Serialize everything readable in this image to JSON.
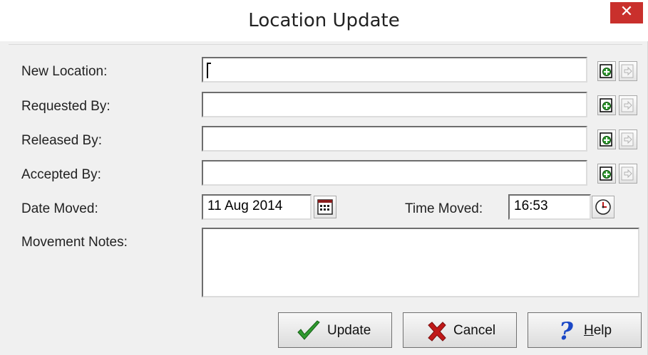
{
  "window": {
    "title": "Location Update",
    "close_glyph": "✕"
  },
  "form": {
    "new_location": {
      "label": "New Location:",
      "value": ""
    },
    "requested_by": {
      "label": "Requested By:",
      "value": ""
    },
    "released_by": {
      "label": "Released By:",
      "value": ""
    },
    "accepted_by": {
      "label": "Accepted By:",
      "value": ""
    },
    "date_moved": {
      "label": "Date Moved:",
      "value": "11 Aug 2014"
    },
    "time_moved": {
      "label": "Time Moved:",
      "value": "16:53"
    },
    "movement_notes": {
      "label": "Movement Notes:",
      "value": ""
    }
  },
  "icons": {
    "add": "add-record-icon",
    "go": "go-to-record-icon",
    "calendar": "calendar-icon",
    "clock": "clock-icon",
    "update": "checkmark-icon",
    "cancel": "x-icon",
    "help": "question-mark-icon"
  },
  "buttons": {
    "update": "Update",
    "cancel": "Cancel",
    "help_prefix": "H",
    "help_rest": "elp"
  },
  "colors": {
    "check_green": "#2f9a2f",
    "cancel_red": "#c01818",
    "help_blue": "#1b48c6",
    "close_red": "#c9302c"
  }
}
